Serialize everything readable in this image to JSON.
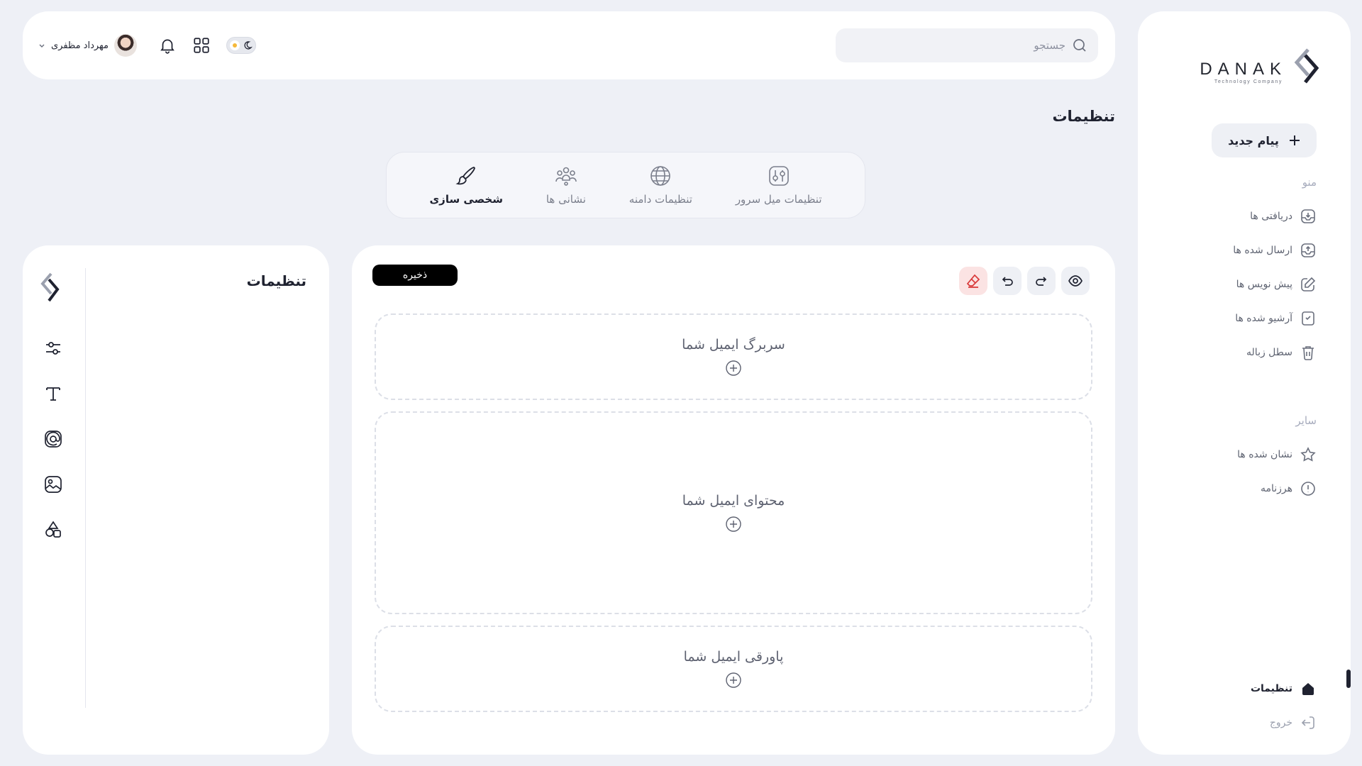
{
  "sidebar": {
    "logo_text": "DANAK",
    "logo_subtext": "Technology Company",
    "new_message_label": "پیام جدید",
    "menu_label": "منو",
    "menu_items": [
      {
        "label": "دریافتی ها",
        "icon": "inbox-icon"
      },
      {
        "label": "ارسال شده ها",
        "icon": "sent-icon"
      },
      {
        "label": "پیش نویس ها",
        "icon": "draft-edit-icon"
      },
      {
        "label": "آرشیو شده ها",
        "icon": "archive-icon"
      },
      {
        "label": "سطل زباله",
        "icon": "trash-icon"
      }
    ],
    "other_label": "سایر",
    "other_items": [
      {
        "label": "نشان شده ها",
        "icon": "star-icon"
      },
      {
        "label": "هرزنامه",
        "icon": "spam-alert-icon"
      }
    ],
    "settings_label": "تنظیمات",
    "logout_label": "خروج"
  },
  "header": {
    "search_placeholder": "جستجو",
    "user_name": "مهرداد مظفری"
  },
  "page": {
    "title": "تنظیمات"
  },
  "tabs": [
    {
      "label": "تنظیمات میل سرور",
      "icon": "server-settings-icon"
    },
    {
      "label": "تنظیمات دامنه",
      "icon": "globe-icon"
    },
    {
      "label": "نشانی ها",
      "icon": "people-icon"
    },
    {
      "label": "شخصی سازی",
      "icon": "brush-icon",
      "active": true
    }
  ],
  "editor": {
    "save_label": "ذخیره",
    "header_zone": "سربرگ ایمیل شما",
    "content_zone": "محتوای ایمیل شما",
    "footer_zone": "پاورقی ایمیل شما"
  },
  "settings_panel": {
    "title": "تنظیمات"
  },
  "colors": {
    "background": "#eef0f6",
    "card": "#ffffff",
    "text": "#1f2230",
    "muted": "#a7acbd",
    "danger": "#d93a3a",
    "toggle_sun": "#f5b83a"
  }
}
